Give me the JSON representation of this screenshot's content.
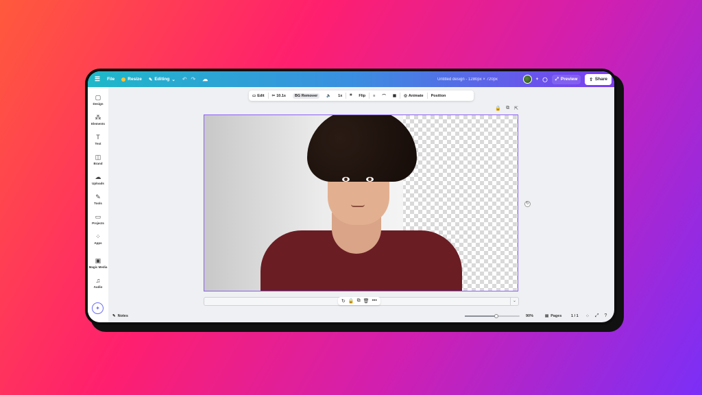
{
  "topbar": {
    "file": "File",
    "resize": "Resize",
    "editing": "Editing",
    "doc_title": "Untitled design - 1280px × 720px",
    "preview": "Preview",
    "share": "Share"
  },
  "sidebar": {
    "items": [
      {
        "label": "Design",
        "icon": "▢"
      },
      {
        "label": "Elements",
        "icon": "⁂"
      },
      {
        "label": "Text",
        "icon": "T"
      },
      {
        "label": "Brand",
        "icon": "◫"
      },
      {
        "label": "Uploads",
        "icon": "☁"
      },
      {
        "label": "Tools",
        "icon": "✎"
      },
      {
        "label": "Projects",
        "icon": "▭"
      },
      {
        "label": "Apps",
        "icon": "⁘"
      },
      {
        "label": "Magic Media",
        "icon": "▣"
      },
      {
        "label": "Audio",
        "icon": "♫"
      }
    ]
  },
  "toolbar": {
    "edit": "Edit",
    "duration": "10.1s",
    "bg_remover": "BG Remover",
    "speed": "1x",
    "flip": "Flip",
    "animate": "Animate",
    "position": "Position"
  },
  "footer": {
    "notes": "Notes",
    "zoom": "90%",
    "zoom_fraction": 0.58,
    "pages": "Pages",
    "page_count": "1 / 1"
  }
}
